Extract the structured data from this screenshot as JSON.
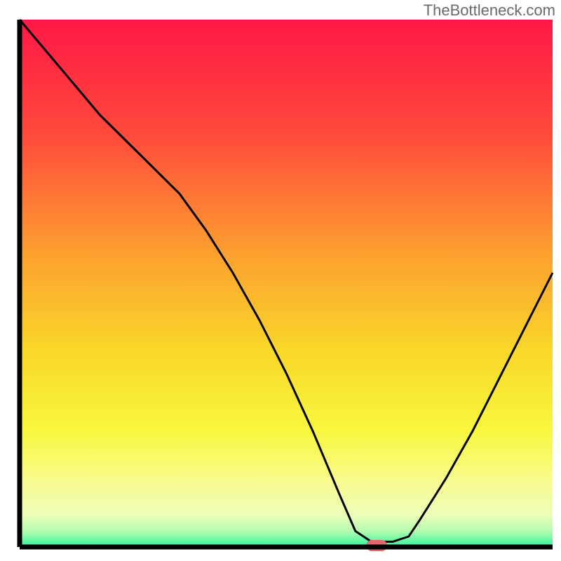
{
  "attribution": "TheBottleneck.com",
  "chart_data": {
    "type": "line",
    "title": "",
    "xlabel": "",
    "ylabel": "",
    "xlim": [
      0,
      100
    ],
    "ylim": [
      0,
      100
    ],
    "series": [
      {
        "name": "bottleneck-curve",
        "x": [
          0,
          5,
          10,
          15,
          20,
          25,
          30,
          35,
          40,
          45,
          50,
          55,
          60,
          63,
          66,
          70,
          73,
          75,
          80,
          85,
          90,
          95,
          100
        ],
        "values": [
          100,
          94,
          88,
          82,
          77,
          72,
          67,
          60,
          52,
          43,
          33,
          22,
          10,
          3,
          1,
          1,
          2,
          5,
          13,
          22,
          32,
          42,
          52
        ]
      }
    ],
    "marker": {
      "x": 67,
      "y": 0,
      "color": "#e0696d"
    },
    "gradient_stops": [
      {
        "offset": 0.0,
        "color": "#ff1846"
      },
      {
        "offset": 0.22,
        "color": "#ff4a3b"
      },
      {
        "offset": 0.45,
        "color": "#fca22f"
      },
      {
        "offset": 0.62,
        "color": "#f9d52a"
      },
      {
        "offset": 0.78,
        "color": "#f8f73e"
      },
      {
        "offset": 0.88,
        "color": "#f9fc93"
      },
      {
        "offset": 0.94,
        "color": "#ecfdb8"
      },
      {
        "offset": 0.97,
        "color": "#b4fbb0"
      },
      {
        "offset": 1.0,
        "color": "#2ef59a"
      }
    ],
    "axis_color": "#000000"
  }
}
